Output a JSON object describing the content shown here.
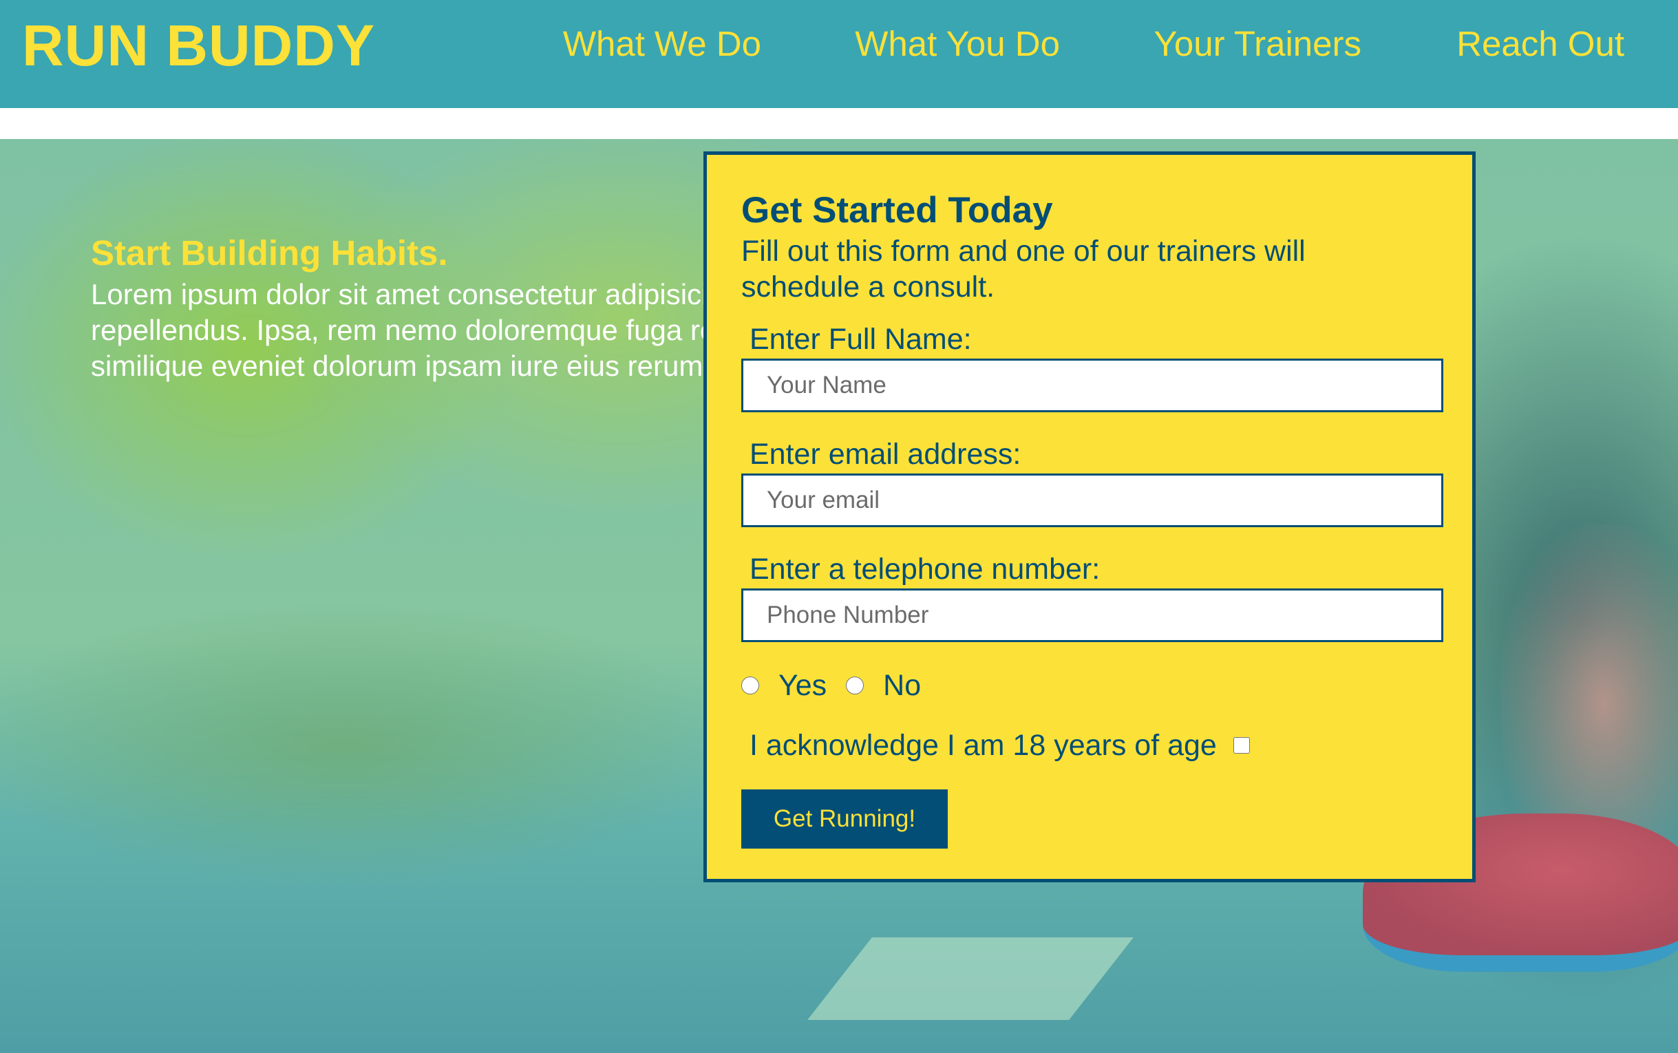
{
  "header": {
    "brand": "RUN BUDDY",
    "nav": [
      "What We Do",
      "What You Do",
      "Your Trainers",
      "Reach Out"
    ]
  },
  "hero": {
    "title": "Start Building Habits.",
    "body": "Lorem ipsum dolor sit amet consectetur adipisicing elit. Quisquam, nemo. Nihil omnis voluptatum quibusdam repellendus. Ipsa, rem nemo doloremque fuga reiciendis officia dolore, voluptatum dignissimos sit voluptas, similique eveniet dolorum ipsam iure eius rerum? Amet dolor nesciunt, impedit illum?"
  },
  "form": {
    "title": "Get Started Today",
    "intro": "Fill out this form and one of our trainers will schedule a consult.",
    "name_label": "Enter Full Name:",
    "name_placeholder": "Your Name",
    "email_label": "Enter email address:",
    "email_placeholder": "Your email",
    "phone_label": "Enter a telephone number:",
    "phone_placeholder": "Phone Number",
    "radio_yes": "Yes",
    "radio_no": "No",
    "ack_label": "I acknowledge I am 18 years of age",
    "submit_label": "Get Running!"
  },
  "colors": {
    "header_bg": "#39a6b2",
    "accent_yellow": "#fce138",
    "dark_blue": "#024e76"
  }
}
